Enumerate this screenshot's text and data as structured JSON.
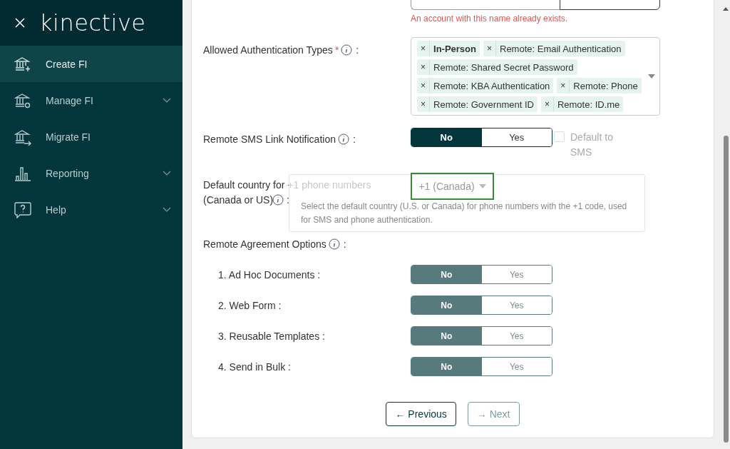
{
  "sidebar": {
    "logo": "kinective",
    "items": [
      {
        "label": "Create FI",
        "selected": true,
        "expandable": false
      },
      {
        "label": "Manage FI",
        "selected": false,
        "expandable": true
      },
      {
        "label": "Migrate FI",
        "selected": false,
        "expandable": false
      },
      {
        "label": "Reporting",
        "selected": false,
        "expandable": true
      },
      {
        "label": "Help",
        "selected": false,
        "expandable": true
      }
    ]
  },
  "colon": ":",
  "integration": {
    "error": "An account with this name already exists."
  },
  "auth_types": {
    "label": "Allowed Authentication Types",
    "required": true,
    "required_mark": "*",
    "remove_mark": "×",
    "chips": [
      {
        "label": "In-Person",
        "bold": true
      },
      {
        "label": "Remote: Email Authentication",
        "bold": false
      },
      {
        "label": "Remote: Shared Secret Password",
        "bold": false
      },
      {
        "label": "Remote: KBA Authentication",
        "bold": false
      },
      {
        "label": "Remote: Phone",
        "bold": false
      },
      {
        "label": "Remote: Government ID",
        "bold": false
      },
      {
        "label": "Remote: ID.me",
        "bold": false
      }
    ]
  },
  "sms": {
    "label": "Remote SMS Link Notification",
    "disabled": false,
    "options": [
      {
        "label": "No",
        "selected": true
      },
      {
        "label": "Yes",
        "selected": false
      }
    ],
    "checkbox": {
      "label": "Default to SMS",
      "checked": false,
      "disabled": true
    }
  },
  "country": {
    "label_lines": [
      "Default country for +1 phone numbers",
      "(Canada or US)"
    ],
    "value": "+1 (Canada)",
    "tooltip": "Select the default country (U.S. or Canada) for phone numbers with the +1 code, used for SMS and phone authentication."
  },
  "remote_agreement": {
    "label": "Remote Agreement Options",
    "options": [
      {
        "label": "1. Ad Hoc Documents :",
        "disabled": true,
        "toggle": [
          {
            "label": "No",
            "selected": true
          },
          {
            "label": "Yes",
            "selected": false
          }
        ]
      },
      {
        "label": "2. Web Form :",
        "disabled": true,
        "toggle": [
          {
            "label": "No",
            "selected": true
          },
          {
            "label": "Yes",
            "selected": false
          }
        ]
      },
      {
        "label": "3. Reusable Templates :",
        "disabled": true,
        "toggle": [
          {
            "label": "No",
            "selected": true
          },
          {
            "label": "Yes",
            "selected": false
          }
        ]
      },
      {
        "label": "4. Send in Bulk :",
        "disabled": true,
        "toggle": [
          {
            "label": "No",
            "selected": true
          },
          {
            "label": "Yes",
            "selected": false
          }
        ]
      }
    ]
  },
  "nav": [
    {
      "label": "← Previous",
      "disabled": false
    },
    {
      "label": "→ Next",
      "disabled": true
    }
  ]
}
